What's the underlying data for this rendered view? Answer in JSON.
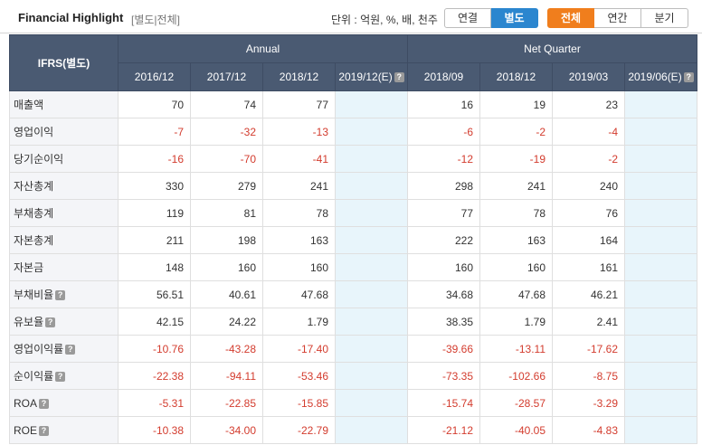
{
  "header": {
    "title": "Financial Highlight",
    "subtitle": "[별도|전체]",
    "unit_text": "단위 : 억원, %, 배, 천주",
    "scope_toggle": [
      {
        "label": "연결",
        "selected": false
      },
      {
        "label": "별도",
        "selected": true
      }
    ],
    "period_toggle": [
      {
        "label": "전체",
        "selected": true
      },
      {
        "label": "연간",
        "selected": false
      },
      {
        "label": "분기",
        "selected": false
      }
    ]
  },
  "table": {
    "row_header": "IFRS(별도)",
    "groups": [
      "Annual",
      "Net Quarter"
    ],
    "periods": [
      "2016/12",
      "2017/12",
      "2018/12",
      "2019/12(E)",
      "2018/09",
      "2018/12",
      "2019/03",
      "2019/06(E)"
    ],
    "estimate_columns": [
      3,
      7
    ],
    "colors": {
      "negative": "#d33c2e",
      "estimate_bg": "#e8f5fb",
      "header_bg": "#4a5a72"
    },
    "rows": [
      {
        "label": "매출액",
        "help": false,
        "values": [
          "70",
          "74",
          "77",
          "",
          "16",
          "19",
          "23",
          ""
        ]
      },
      {
        "label": "영업이익",
        "help": false,
        "values": [
          "-7",
          "-32",
          "-13",
          "",
          "-6",
          "-2",
          "-4",
          ""
        ]
      },
      {
        "label": "당기순이익",
        "help": false,
        "values": [
          "-16",
          "-70",
          "-41",
          "",
          "-12",
          "-19",
          "-2",
          ""
        ]
      },
      {
        "label": "자산총계",
        "help": false,
        "values": [
          "330",
          "279",
          "241",
          "",
          "298",
          "241",
          "240",
          ""
        ]
      },
      {
        "label": "부채총계",
        "help": false,
        "values": [
          "119",
          "81",
          "78",
          "",
          "77",
          "78",
          "76",
          ""
        ]
      },
      {
        "label": "자본총계",
        "help": false,
        "values": [
          "211",
          "198",
          "163",
          "",
          "222",
          "163",
          "164",
          ""
        ]
      },
      {
        "label": "자본금",
        "help": false,
        "values": [
          "148",
          "160",
          "160",
          "",
          "160",
          "160",
          "161",
          ""
        ]
      },
      {
        "label": "부채비율",
        "help": true,
        "values": [
          "56.51",
          "40.61",
          "47.68",
          "",
          "34.68",
          "47.68",
          "46.21",
          ""
        ]
      },
      {
        "label": "유보율",
        "help": true,
        "values": [
          "42.15",
          "24.22",
          "1.79",
          "",
          "38.35",
          "1.79",
          "2.41",
          ""
        ]
      },
      {
        "label": "영업이익률",
        "help": true,
        "values": [
          "-10.76",
          "-43.28",
          "-17.40",
          "",
          "-39.66",
          "-13.11",
          "-17.62",
          ""
        ]
      },
      {
        "label": "순이익률",
        "help": true,
        "values": [
          "-22.38",
          "-94.11",
          "-53.46",
          "",
          "-73.35",
          "-102.66",
          "-8.75",
          ""
        ]
      },
      {
        "label": "ROA",
        "help": true,
        "values": [
          "-5.31",
          "-22.85",
          "-15.85",
          "",
          "-15.74",
          "-28.57",
          "-3.29",
          ""
        ]
      },
      {
        "label": "ROE",
        "help": true,
        "values": [
          "-10.38",
          "-34.00",
          "-22.79",
          "",
          "-21.12",
          "-40.05",
          "-4.83",
          ""
        ]
      }
    ]
  }
}
